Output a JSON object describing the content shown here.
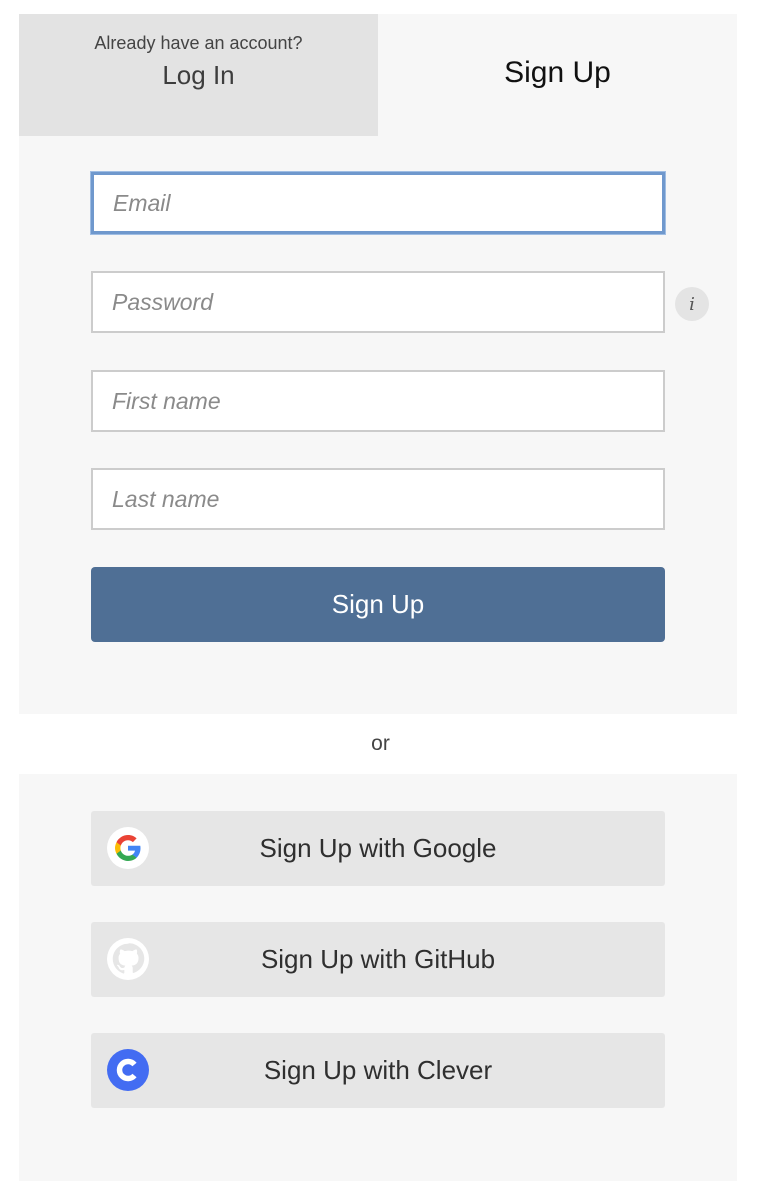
{
  "tabs": {
    "login_hint": "Already have an account?",
    "login_label": "Log In",
    "signup_label": "Sign Up"
  },
  "form": {
    "email_placeholder": "Email",
    "email_value": "",
    "password_placeholder": "Password",
    "password_value": "",
    "first_name_placeholder": "First name",
    "first_name_value": "",
    "last_name_placeholder": "Last name",
    "last_name_value": "",
    "info_symbol": "i",
    "submit_label": "Sign Up"
  },
  "divider": "or",
  "social": {
    "google_label": "Sign Up with Google",
    "github_label": "Sign Up with GitHub",
    "clever_label": "Sign Up with Clever"
  },
  "icons": {
    "info": "info-icon",
    "google": "google-icon",
    "github": "github-icon",
    "clever": "clever-icon"
  },
  "colors": {
    "primary_button": "#4f6f95",
    "focus_ring": "#6f98cd",
    "clever_blue": "#436cf2",
    "panel_bg": "#f7f7f7",
    "inactive_tab_bg": "#e3e3e3"
  }
}
